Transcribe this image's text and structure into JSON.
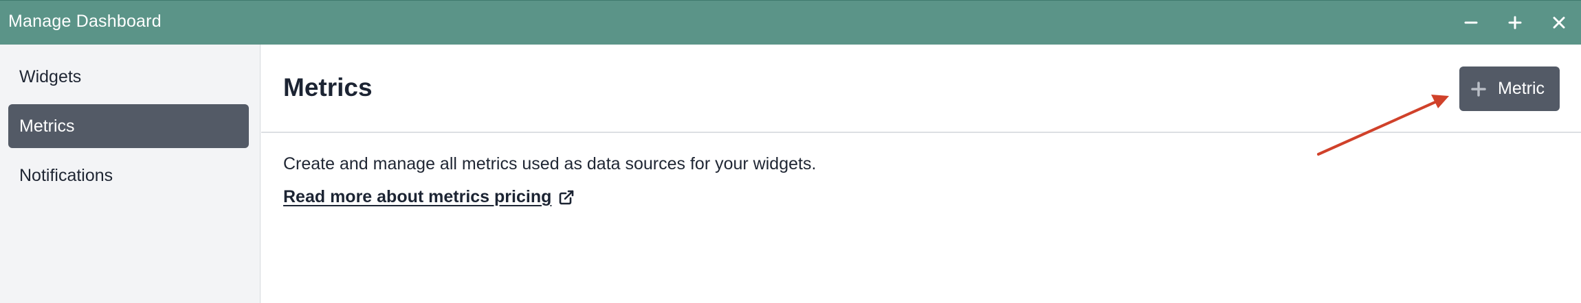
{
  "window": {
    "title": "Manage Dashboard",
    "controls": {
      "minimize_icon": "minus-icon",
      "maximize_icon": "plus-icon",
      "close_icon": "close-icon"
    },
    "titlebar_color": "#5b9488"
  },
  "sidebar": {
    "items": [
      {
        "label": "Widgets",
        "active": false
      },
      {
        "label": "Metrics",
        "active": true
      },
      {
        "label": "Notifications",
        "active": false
      }
    ],
    "active_color": "#535a66"
  },
  "main": {
    "title": "Metrics",
    "add_button": {
      "icon": "plus-icon",
      "label": "Metric"
    },
    "description": "Create and manage all metrics used as data sources for your widgets.",
    "pricing_link": {
      "label": "Read more about metrics pricing",
      "icon": "external-link-icon"
    }
  },
  "annotation": {
    "type": "arrow",
    "color": "#d0412a",
    "points_to": "add-metric-button"
  }
}
